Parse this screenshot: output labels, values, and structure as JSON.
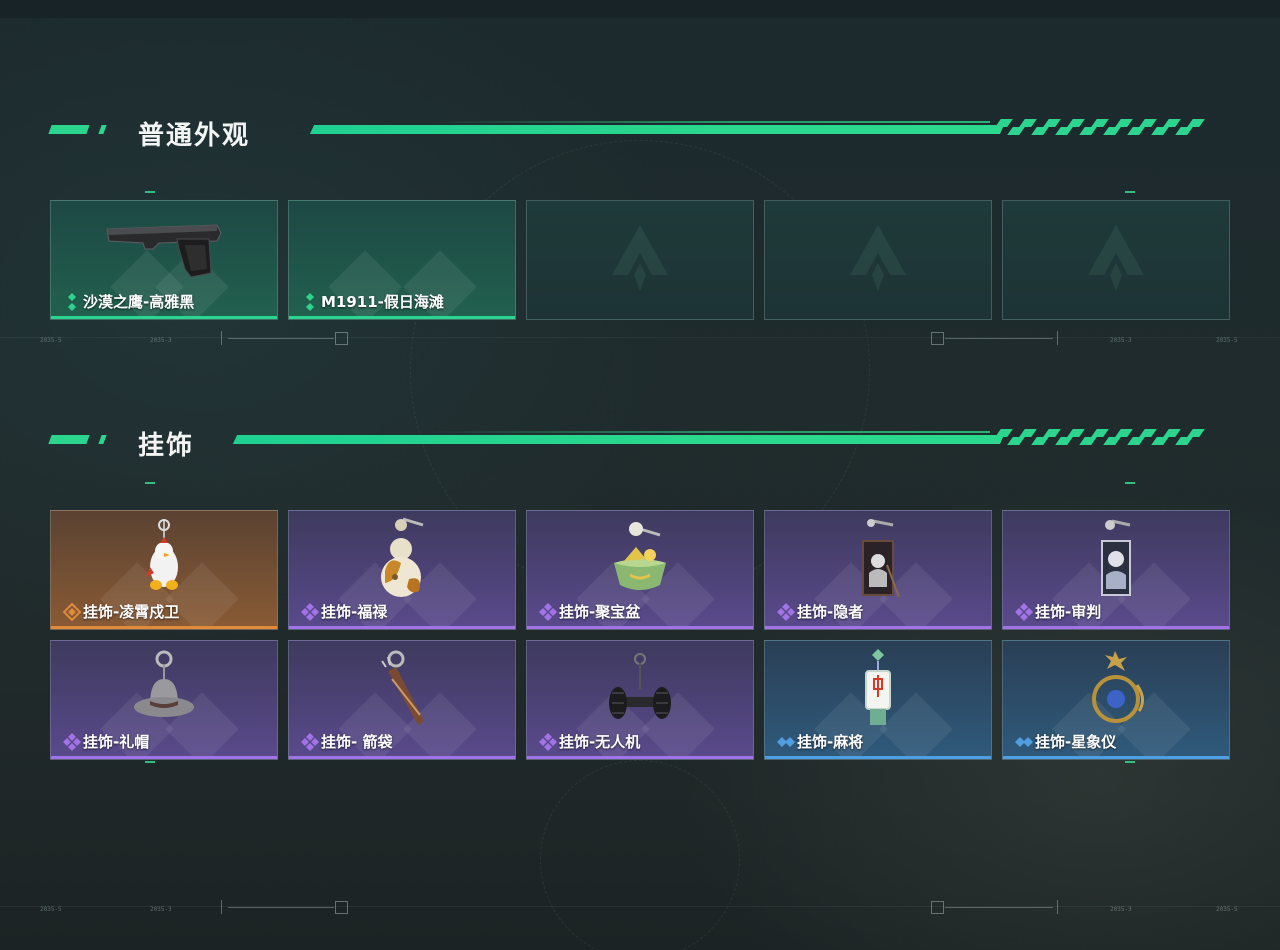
{
  "sections": [
    {
      "title": "普通外观",
      "cards": [
        {
          "label": "沙漠之鹰-高雅黑",
          "rarity": "green",
          "item_icon": "pistol-icon"
        },
        {
          "label": "M1911-假日海滩",
          "rarity": "green",
          "item_icon": ""
        },
        {
          "label": "",
          "rarity": "empty",
          "item_icon": "logo-placeholder-icon"
        },
        {
          "label": "",
          "rarity": "empty",
          "item_icon": "logo-placeholder-icon"
        },
        {
          "label": "",
          "rarity": "empty",
          "item_icon": "logo-placeholder-icon"
        }
      ]
    },
    {
      "title": "挂饰",
      "cards": [
        {
          "label": "挂饰-凌霄戍卫",
          "rarity": "orange",
          "item_icon": "chicken-charm-icon"
        },
        {
          "label": "挂饰-福禄",
          "rarity": "purple",
          "item_icon": "gourd-charm-icon"
        },
        {
          "label": "挂饰-聚宝盆",
          "rarity": "purple",
          "item_icon": "treasure-bowl-charm-icon"
        },
        {
          "label": "挂饰-隐者",
          "rarity": "purple",
          "item_icon": "tarot-hermit-charm-icon"
        },
        {
          "label": "挂饰-审判",
          "rarity": "purple",
          "item_icon": "tarot-judgement-charm-icon"
        },
        {
          "label": "挂饰-礼帽",
          "rarity": "purple",
          "item_icon": "hat-charm-icon"
        },
        {
          "label": "挂饰- 箭袋",
          "rarity": "purple",
          "item_icon": "quiver-charm-icon"
        },
        {
          "label": "挂饰-无人机",
          "rarity": "purple",
          "item_icon": "drone-charm-icon"
        },
        {
          "label": "挂饰-麻将",
          "rarity": "blue",
          "item_icon": "mahjong-charm-icon"
        },
        {
          "label": "挂饰-星象仪",
          "rarity": "blue",
          "item_icon": "astrolabe-charm-icon"
        }
      ]
    }
  ],
  "colors": {
    "accent": "#2bd58d",
    "green": "#2bd58d",
    "orange": "#e08a3a",
    "purple": "#a273e6",
    "blue": "#4f9ee0"
  },
  "deco_text": [
    "2035-5",
    "2035-3"
  ]
}
